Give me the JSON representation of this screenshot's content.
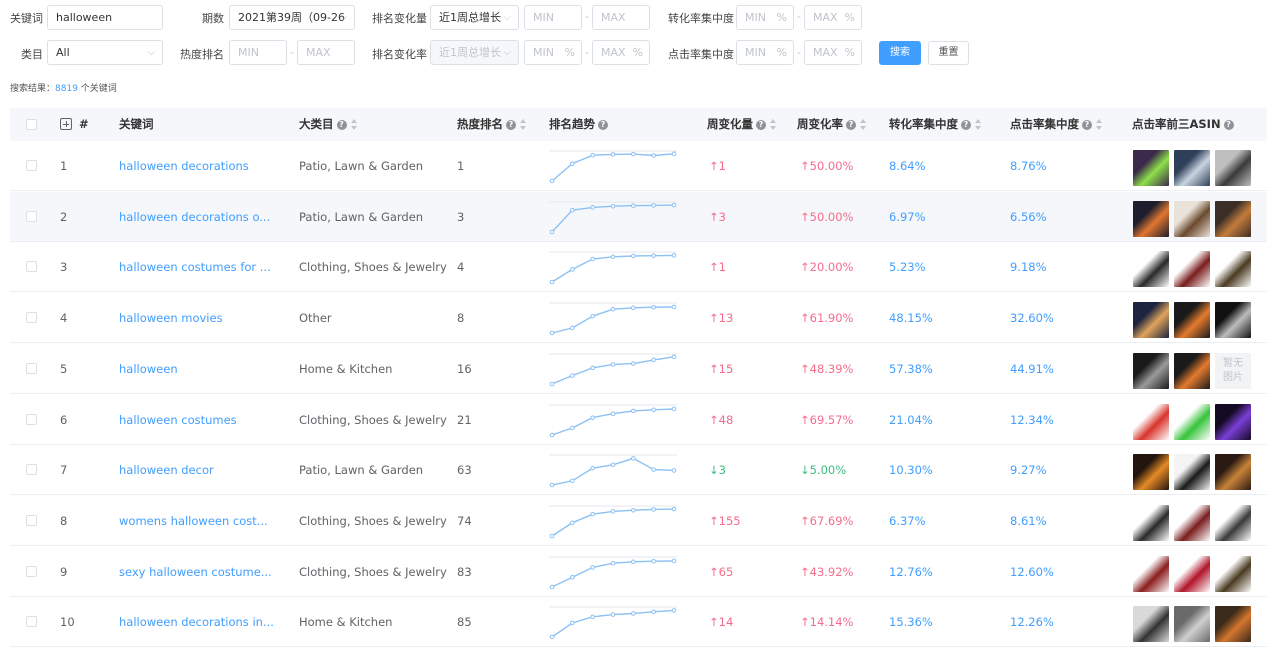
{
  "filters": {
    "keyword_label": "关键词",
    "keyword_value": "halloween",
    "period_label": "期数",
    "period_value": "2021第39周（09-26",
    "rank_change_label": "排名变化量",
    "rank_change_value": "近1周总增长",
    "min": "MIN",
    "max": "MAX",
    "pct": "%",
    "conversion_label": "转化率集中度",
    "category_label": "类目",
    "category_value": "All",
    "hot_rank_label": "热度排名",
    "rank_rate_label": "排名变化率",
    "rank_rate_value": "近1周总增长",
    "click_label": "点击率集中度",
    "search_btn": "搜索",
    "reset_btn": "重置"
  },
  "result": {
    "prefix": "搜索结果：",
    "count": "8819",
    "suffix": " 个关键词"
  },
  "table": {
    "headers": {
      "index": "#",
      "keyword": "关键词",
      "category": "大类目",
      "hot_rank": "热度排名",
      "trend": "排名趋势",
      "weekly_change": "周变化量",
      "weekly_rate": "周变化率",
      "conversion": "转化率集中度",
      "click": "点击率集中度",
      "asin": "点击率前三ASIN"
    },
    "no_image": [
      "暂无",
      "图片"
    ],
    "rows": [
      {
        "idx": "1",
        "keyword": "halloween decorations",
        "category": "Patio, Lawn & Garden",
        "rank": "1",
        "change": "↑1",
        "rate": "↑50.00%",
        "dir": "up",
        "conv": "8.64%",
        "click": "8.76%",
        "trend": [
          0,
          0.62,
          0.92,
          0.95,
          0.96,
          0.91,
          0.97
        ],
        "thumbs": [
          {
            "bg": "#3b2a4a",
            "fg": "#8ee04a"
          },
          {
            "bg": "#2e3f59",
            "fg": "#c9d4e0"
          },
          {
            "bg": "#bfbfbf",
            "fg": "#3a3a3a"
          }
        ]
      },
      {
        "idx": "2",
        "keyword": "halloween decorations o...",
        "category": "Patio, Lawn & Garden",
        "rank": "3",
        "change": "↑3",
        "rate": "↑50.00%",
        "dir": "up",
        "conv": "6.97%",
        "click": "6.56%",
        "trend": [
          0,
          0.78,
          0.88,
          0.92,
          0.94,
          0.95,
          0.96
        ],
        "thumbs": [
          {
            "bg": "#1d1d2e",
            "fg": "#e0762f"
          },
          {
            "bg": "#e9e2d8",
            "fg": "#6a4a2d"
          },
          {
            "bg": "#3a2e26",
            "fg": "#c47c3c"
          }
        ]
      },
      {
        "idx": "3",
        "keyword": "halloween costumes for ...",
        "category": "Clothing, Shoes & Jewelry",
        "rank": "4",
        "change": "↑1",
        "rate": "↑20.00%",
        "dir": "up",
        "conv": "5.23%",
        "click": "9.18%",
        "trend": [
          0,
          0.45,
          0.82,
          0.9,
          0.93,
          0.94,
          0.95
        ],
        "thumbs": [
          {
            "bg": "#ffffff",
            "fg": "#2a2a2a"
          },
          {
            "bg": "#ffffff",
            "fg": "#7a1d1d"
          },
          {
            "bg": "#ffffff",
            "fg": "#4a3a20"
          }
        ]
      },
      {
        "idx": "4",
        "keyword": "halloween movies",
        "category": "Other",
        "rank": "8",
        "change": "↑13",
        "rate": "↑61.90%",
        "dir": "up",
        "conv": "48.15%",
        "click": "32.60%",
        "trend": [
          0,
          0.18,
          0.6,
          0.85,
          0.9,
          0.92,
          0.93
        ],
        "thumbs": [
          {
            "bg": "#1c2440",
            "fg": "#e0a35a"
          },
          {
            "bg": "#1a1a1a",
            "fg": "#e47a2e"
          },
          {
            "bg": "#111111",
            "fg": "#bdbdbd"
          }
        ]
      },
      {
        "idx": "5",
        "keyword": "halloween",
        "category": "Home & Kitchen",
        "rank": "16",
        "change": "↑15",
        "rate": "↑48.39%",
        "dir": "up",
        "conv": "57.38%",
        "click": "44.91%",
        "trend": [
          0,
          0.3,
          0.58,
          0.7,
          0.73,
          0.86,
          0.97
        ],
        "thumbs": [
          {
            "bg": "#1a1a1a",
            "fg": "#9a9a9a"
          },
          {
            "bg": "#1a1a1a",
            "fg": "#e47a2e"
          }
        ],
        "noimg": true
      },
      {
        "idx": "6",
        "keyword": "halloween costumes",
        "category": "Clothing, Shoes & Jewelry",
        "rank": "21",
        "change": "↑48",
        "rate": "↑69.57%",
        "dir": "up",
        "conv": "21.04%",
        "click": "12.34%",
        "trend": [
          0,
          0.25,
          0.62,
          0.76,
          0.86,
          0.9,
          0.93
        ],
        "thumbs": [
          {
            "bg": "#ffffff",
            "fg": "#d8332a"
          },
          {
            "bg": "#ffffff",
            "fg": "#36c33a"
          },
          {
            "bg": "#140a24",
            "fg": "#7b3fd6"
          }
        ]
      },
      {
        "idx": "7",
        "keyword": "halloween decor",
        "category": "Patio, Lawn & Garden",
        "rank": "63",
        "change": "↓3",
        "rate": "↓5.00%",
        "dir": "down",
        "conv": "10.30%",
        "click": "9.27%",
        "trend": [
          0,
          0.15,
          0.6,
          0.72,
          0.95,
          0.55,
          0.52
        ],
        "thumbs": [
          {
            "bg": "#23160e",
            "fg": "#e58a25"
          },
          {
            "bg": "#f4f4f4",
            "fg": "#1a1a1a"
          },
          {
            "bg": "#2a1a12",
            "fg": "#c9843a"
          }
        ]
      },
      {
        "idx": "8",
        "keyword": "womens halloween cost...",
        "category": "Clothing, Shoes & Jewelry",
        "rank": "74",
        "change": "↑155",
        "rate": "↑67.69%",
        "dir": "up",
        "conv": "6.37%",
        "click": "8.61%",
        "trend": [
          0,
          0.47,
          0.78,
          0.88,
          0.92,
          0.95,
          0.96
        ],
        "thumbs": [
          {
            "bg": "#ffffff",
            "fg": "#2a2a2a"
          },
          {
            "bg": "#ffffff",
            "fg": "#7a1d1d"
          },
          {
            "bg": "#ffffff",
            "fg": "#3a3a3a"
          }
        ]
      },
      {
        "idx": "9",
        "keyword": "sexy halloween costume...",
        "category": "Clothing, Shoes & Jewelry",
        "rank": "83",
        "change": "↑65",
        "rate": "↑43.92%",
        "dir": "up",
        "conv": "12.76%",
        "click": "12.60%",
        "trend": [
          0,
          0.35,
          0.7,
          0.85,
          0.9,
          0.92,
          0.93
        ],
        "thumbs": [
          {
            "bg": "#ffffff",
            "fg": "#8a1d1d"
          },
          {
            "bg": "#ffffff",
            "fg": "#b0142a"
          },
          {
            "bg": "#ffffff",
            "fg": "#4a3a20"
          }
        ]
      },
      {
        "idx": "10",
        "keyword": "halloween decorations in...",
        "category": "Home & Kitchen",
        "rank": "85",
        "change": "↑14",
        "rate": "↑14.14%",
        "dir": "up",
        "conv": "15.36%",
        "click": "12.26%",
        "trend": [
          0,
          0.5,
          0.72,
          0.8,
          0.84,
          0.9,
          0.95
        ],
        "thumbs": [
          {
            "bg": "#d9d9d9",
            "fg": "#333333"
          },
          {
            "bg": "#6a6a6a",
            "fg": "#cfcfcf"
          },
          {
            "bg": "#3a2a1a",
            "fg": "#d4752f"
          }
        ]
      }
    ]
  }
}
